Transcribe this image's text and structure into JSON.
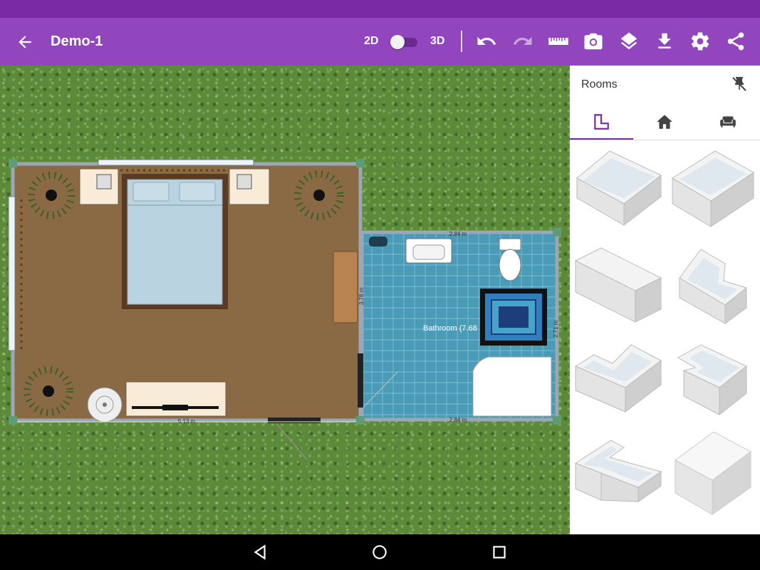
{
  "app": {
    "title": "Demo-1"
  },
  "toolbar": {
    "label_2d": "2D",
    "label_3d": "3D",
    "icons": [
      "undo-icon",
      "redo-icon",
      "ruler-icon",
      "camera-icon",
      "layers-icon",
      "download-icon",
      "settings-icon",
      "share-icon"
    ]
  },
  "plan": {
    "bedroom": {
      "width_label": "5.13 m"
    },
    "bathroom": {
      "label": "Bathroom (7.68",
      "top_width_label": "2.84 m",
      "bottom_width_label": "2.84 m",
      "left_height_label": "3.78 m",
      "right_height_label": "2.71 m"
    }
  },
  "panel": {
    "title": "Rooms",
    "tabs": [
      {
        "name": "rooms",
        "icon": "room-corner-icon",
        "active": true
      },
      {
        "name": "house",
        "icon": "house-icon",
        "active": false
      },
      {
        "name": "furniture",
        "icon": "sofa-icon",
        "active": false
      }
    ],
    "room_shapes": [
      "rectangle-room",
      "square-room",
      "wide-room",
      "notched-room",
      "l-shape-room",
      "corner-cut-room",
      "t-shape-room",
      "solid-block"
    ]
  },
  "colors": {
    "accent": "#9146bd",
    "status": "#7b2aa6",
    "floor_bedroom": "#8a6a45",
    "floor_bath": "#4a9bb8"
  }
}
